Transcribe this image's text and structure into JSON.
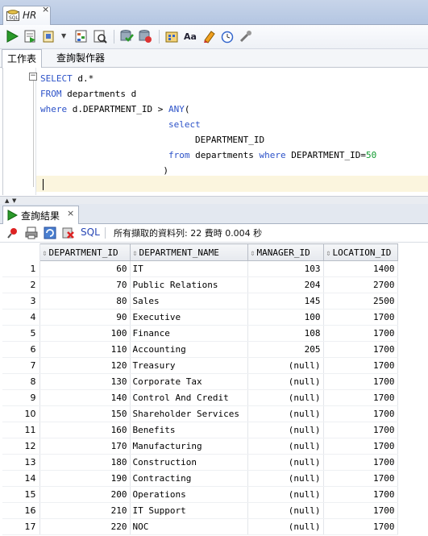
{
  "document_tab": {
    "title": "HR",
    "close": "×"
  },
  "toolbar_icons": [
    "run-statement-icon",
    "run-script-icon",
    "autotrace-icon",
    "dropdown-icon",
    "explain-plan-icon",
    "sql-tuning-icon",
    "commit-icon",
    "rollback-icon",
    "unshared-sql-icon",
    "to-upper-icon",
    "clear-icon",
    "sql-history-icon",
    "tools-icon"
  ],
  "subtabs": {
    "worksheet": "工作表",
    "query_builder": "查詢製作器"
  },
  "editor": {
    "lines": [
      [
        {
          "t": "SELECT",
          "c": "kw"
        },
        {
          "t": " d.*",
          "c": ""
        }
      ],
      [
        {
          "t": "FROM",
          "c": "kw"
        },
        {
          "t": " departments d",
          "c": ""
        }
      ],
      [
        {
          "t": "where",
          "c": "kw"
        },
        {
          "t": " d.DEPARTMENT_ID > ",
          "c": ""
        },
        {
          "t": "ANY",
          "c": "kw"
        },
        {
          "t": "(",
          "c": ""
        }
      ],
      [
        {
          "t": "                        ",
          "c": ""
        },
        {
          "t": "select",
          "c": "kw"
        }
      ],
      [
        {
          "t": "                             DEPARTMENT_ID",
          "c": ""
        }
      ],
      [
        {
          "t": "                        ",
          "c": ""
        },
        {
          "t": "from",
          "c": "kw"
        },
        {
          "t": " departments ",
          "c": ""
        },
        {
          "t": "where",
          "c": "kw"
        },
        {
          "t": " DEPARTMENT_ID=",
          "c": ""
        },
        {
          "t": "50",
          "c": "num"
        }
      ],
      [
        {
          "t": "                       )",
          "c": ""
        }
      ],
      [
        {
          "t": "",
          "c": ""
        }
      ]
    ]
  },
  "results_tab": {
    "label": "查詢結果",
    "close": "×"
  },
  "results_toolbar": {
    "sql_label": "SQL",
    "message": "所有擷取的資料列: 22 費時 0.004 秒"
  },
  "grid": {
    "columns": [
      "DEPARTMENT_ID",
      "DEPARTMENT_NAME",
      "MANAGER_ID",
      "LOCATION_ID"
    ],
    "rows": [
      [
        "1",
        "60",
        "IT",
        "103",
        "1400"
      ],
      [
        "2",
        "70",
        "Public Relations",
        "204",
        "2700"
      ],
      [
        "3",
        "80",
        "Sales",
        "145",
        "2500"
      ],
      [
        "4",
        "90",
        "Executive",
        "100",
        "1700"
      ],
      [
        "5",
        "100",
        "Finance",
        "108",
        "1700"
      ],
      [
        "6",
        "110",
        "Accounting",
        "205",
        "1700"
      ],
      [
        "7",
        "120",
        "Treasury",
        "(null)",
        "1700"
      ],
      [
        "8",
        "130",
        "Corporate Tax",
        "(null)",
        "1700"
      ],
      [
        "9",
        "140",
        "Control And Credit",
        "(null)",
        "1700"
      ],
      [
        "10",
        "150",
        "Shareholder Services",
        "(null)",
        "1700"
      ],
      [
        "11",
        "160",
        "Benefits",
        "(null)",
        "1700"
      ],
      [
        "12",
        "170",
        "Manufacturing",
        "(null)",
        "1700"
      ],
      [
        "13",
        "180",
        "Construction",
        "(null)",
        "1700"
      ],
      [
        "14",
        "190",
        "Contracting",
        "(null)",
        "1700"
      ],
      [
        "15",
        "200",
        "Operations",
        "(null)",
        "1700"
      ],
      [
        "16",
        "210",
        "IT Support",
        "(null)",
        "1700"
      ],
      [
        "17",
        "220",
        "NOC",
        "(null)",
        "1700"
      ]
    ]
  },
  "colors": {
    "keyword": "#2c52c8",
    "number": "#0f9a2e",
    "current_line": "#fbf5de",
    "run_green": "#2a9a2a"
  }
}
